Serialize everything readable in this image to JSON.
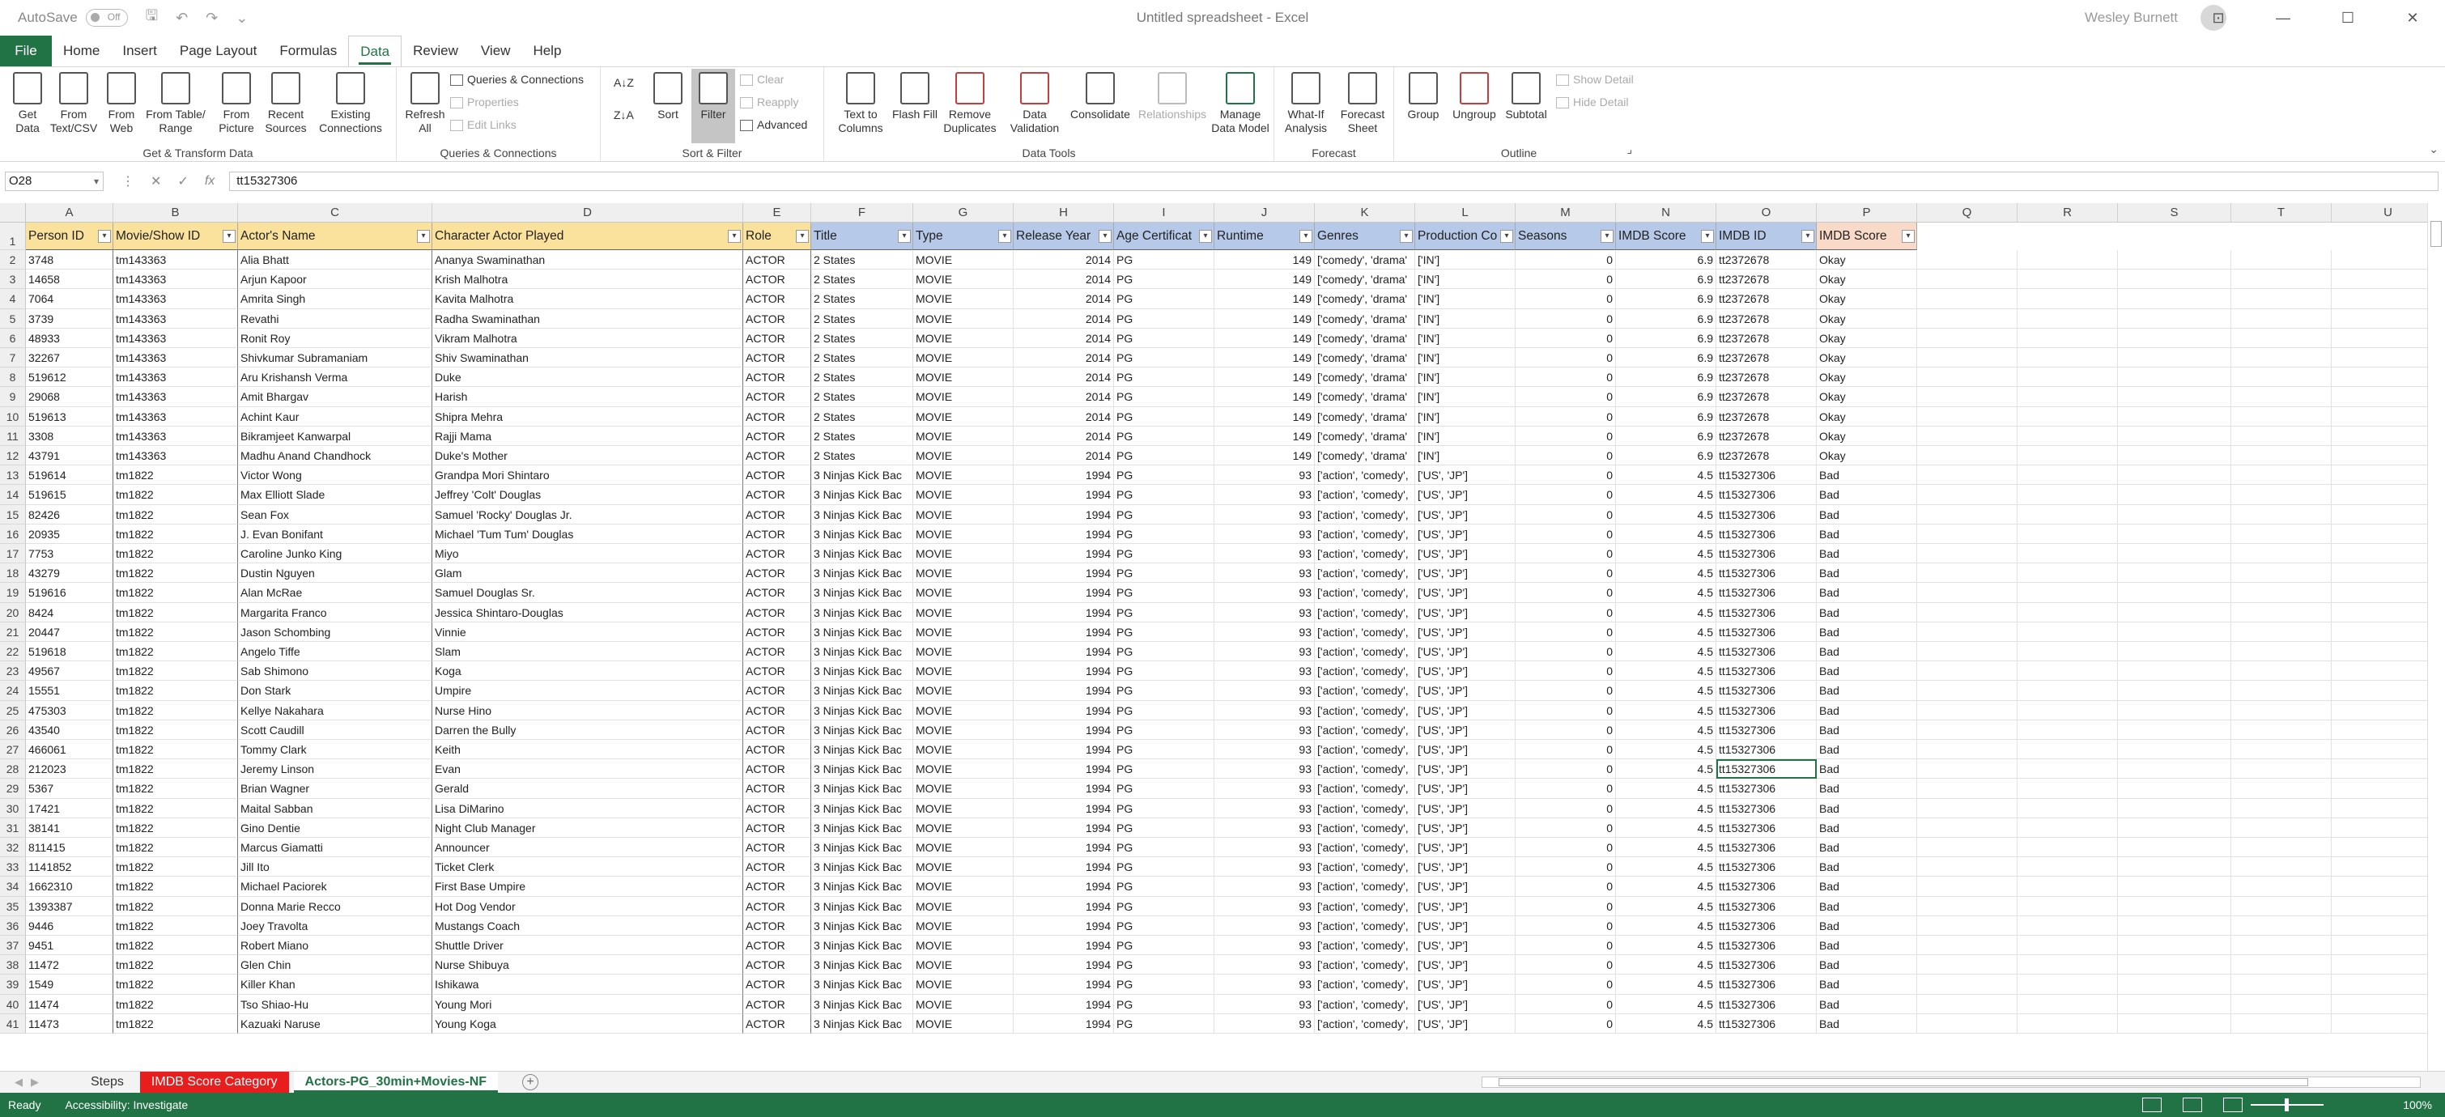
{
  "titlebar": {
    "autosave_label": "AutoSave",
    "autosave_state": "Off",
    "doc_title": "Untitled spreadsheet  -  Excel",
    "user_name": "Wesley Burnett"
  },
  "menu": {
    "file": "File",
    "tabs": [
      "Home",
      "Insert",
      "Page Layout",
      "Formulas",
      "Data",
      "Review",
      "View",
      "Help"
    ],
    "active_tab": "Data"
  },
  "ribbon": {
    "get_transform": {
      "name": "Get & Transform Data",
      "buttons": [
        "Get Data",
        "From Text/CSV",
        "From Web",
        "From Table/ Range",
        "From Picture",
        "Recent Sources",
        "Existing Connections"
      ]
    },
    "queries": {
      "name": "Queries & Connections",
      "refresh": "Refresh All",
      "items": [
        "Queries & Connections",
        "Properties",
        "Edit Links"
      ]
    },
    "sort_filter": {
      "name": "Sort & Filter",
      "sort": "Sort",
      "filter": "Filter",
      "items": [
        "Clear",
        "Reapply",
        "Advanced"
      ]
    },
    "data_tools": {
      "name": "Data Tools",
      "buttons": [
        "Text to Columns",
        "Flash Fill",
        "Remove Duplicates",
        "Data Validation",
        "Consolidate",
        "Relationships",
        "Manage Data Model"
      ]
    },
    "forecast": {
      "name": "Forecast",
      "buttons": [
        "What-If Analysis",
        "Forecast Sheet"
      ]
    },
    "outline": {
      "name": "Outline",
      "buttons": [
        "Group",
        "Ungroup",
        "Subtotal"
      ],
      "items": [
        "Show Detail",
        "Hide Detail"
      ]
    }
  },
  "formula_bar": {
    "name_box": "O28",
    "formula": "tt15327306"
  },
  "columns": [
    "A",
    "B",
    "C",
    "D",
    "E",
    "F",
    "G",
    "H",
    "I",
    "J",
    "K",
    "L",
    "M",
    "N",
    "O",
    "P",
    "Q",
    "R",
    "S",
    "T",
    "U"
  ],
  "headers": [
    "Person ID",
    "Movie/Show ID",
    "Actor's Name",
    "Character Actor Played",
    "Role",
    "Title",
    "Type",
    "Release Year",
    "Age Certificat",
    "Runtime",
    "Genres",
    "Production Co",
    "Seasons",
    "IMDB Score",
    "IMDB ID",
    "IMDB Score"
  ],
  "rows": [
    [
      "3748",
      "tm143363",
      "Alia Bhatt",
      "Ananya Swaminathan",
      "ACTOR",
      "2 States",
      "MOVIE",
      "2014",
      "PG",
      "149",
      "['comedy', 'drama'",
      "['IN']",
      "0",
      "6.9",
      "tt2372678",
      "Okay"
    ],
    [
      "14658",
      "tm143363",
      "Arjun Kapoor",
      "Krish Malhotra",
      "ACTOR",
      "2 States",
      "MOVIE",
      "2014",
      "PG",
      "149",
      "['comedy', 'drama'",
      "['IN']",
      "0",
      "6.9",
      "tt2372678",
      "Okay"
    ],
    [
      "7064",
      "tm143363",
      "Amrita Singh",
      "Kavita Malhotra",
      "ACTOR",
      "2 States",
      "MOVIE",
      "2014",
      "PG",
      "149",
      "['comedy', 'drama'",
      "['IN']",
      "0",
      "6.9",
      "tt2372678",
      "Okay"
    ],
    [
      "3739",
      "tm143363",
      "Revathi",
      "Radha Swaminathan",
      "ACTOR",
      "2 States",
      "MOVIE",
      "2014",
      "PG",
      "149",
      "['comedy', 'drama'",
      "['IN']",
      "0",
      "6.9",
      "tt2372678",
      "Okay"
    ],
    [
      "48933",
      "tm143363",
      "Ronit Roy",
      "Vikram Malhotra",
      "ACTOR",
      "2 States",
      "MOVIE",
      "2014",
      "PG",
      "149",
      "['comedy', 'drama'",
      "['IN']",
      "0",
      "6.9",
      "tt2372678",
      "Okay"
    ],
    [
      "32267",
      "tm143363",
      "Shivkumar Subramaniam",
      "Shiv Swaminathan",
      "ACTOR",
      "2 States",
      "MOVIE",
      "2014",
      "PG",
      "149",
      "['comedy', 'drama'",
      "['IN']",
      "0",
      "6.9",
      "tt2372678",
      "Okay"
    ],
    [
      "519612",
      "tm143363",
      "Aru Krishansh Verma",
      "Duke",
      "ACTOR",
      "2 States",
      "MOVIE",
      "2014",
      "PG",
      "149",
      "['comedy', 'drama'",
      "['IN']",
      "0",
      "6.9",
      "tt2372678",
      "Okay"
    ],
    [
      "29068",
      "tm143363",
      "Amit Bhargav",
      "Harish",
      "ACTOR",
      "2 States",
      "MOVIE",
      "2014",
      "PG",
      "149",
      "['comedy', 'drama'",
      "['IN']",
      "0",
      "6.9",
      "tt2372678",
      "Okay"
    ],
    [
      "519613",
      "tm143363",
      "Achint Kaur",
      "Shipra Mehra",
      "ACTOR",
      "2 States",
      "MOVIE",
      "2014",
      "PG",
      "149",
      "['comedy', 'drama'",
      "['IN']",
      "0",
      "6.9",
      "tt2372678",
      "Okay"
    ],
    [
      "3308",
      "tm143363",
      "Bikramjeet Kanwarpal",
      "Rajji Mama",
      "ACTOR",
      "2 States",
      "MOVIE",
      "2014",
      "PG",
      "149",
      "['comedy', 'drama'",
      "['IN']",
      "0",
      "6.9",
      "tt2372678",
      "Okay"
    ],
    [
      "43791",
      "tm143363",
      "Madhu Anand Chandhock",
      "Duke's Mother",
      "ACTOR",
      "2 States",
      "MOVIE",
      "2014",
      "PG",
      "149",
      "['comedy', 'drama'",
      "['IN']",
      "0",
      "6.9",
      "tt2372678",
      "Okay"
    ],
    [
      "519614",
      "tm1822",
      "Victor Wong",
      "Grandpa Mori Shintaro",
      "ACTOR",
      "3 Ninjas Kick Bac",
      "MOVIE",
      "1994",
      "PG",
      "93",
      "['action', 'comedy',",
      "['US', 'JP']",
      "0",
      "4.5",
      "tt15327306",
      "Bad"
    ],
    [
      "519615",
      "tm1822",
      "Max Elliott Slade",
      "Jeffrey 'Colt' Douglas",
      "ACTOR",
      "3 Ninjas Kick Bac",
      "MOVIE",
      "1994",
      "PG",
      "93",
      "['action', 'comedy',",
      "['US', 'JP']",
      "0",
      "4.5",
      "tt15327306",
      "Bad"
    ],
    [
      "82426",
      "tm1822",
      "Sean Fox",
      "Samuel 'Rocky' Douglas Jr.",
      "ACTOR",
      "3 Ninjas Kick Bac",
      "MOVIE",
      "1994",
      "PG",
      "93",
      "['action', 'comedy',",
      "['US', 'JP']",
      "0",
      "4.5",
      "tt15327306",
      "Bad"
    ],
    [
      "20935",
      "tm1822",
      "J. Evan Bonifant",
      "Michael 'Tum Tum' Douglas",
      "ACTOR",
      "3 Ninjas Kick Bac",
      "MOVIE",
      "1994",
      "PG",
      "93",
      "['action', 'comedy',",
      "['US', 'JP']",
      "0",
      "4.5",
      "tt15327306",
      "Bad"
    ],
    [
      "7753",
      "tm1822",
      "Caroline Junko King",
      "Miyo",
      "ACTOR",
      "3 Ninjas Kick Bac",
      "MOVIE",
      "1994",
      "PG",
      "93",
      "['action', 'comedy',",
      "['US', 'JP']",
      "0",
      "4.5",
      "tt15327306",
      "Bad"
    ],
    [
      "43279",
      "tm1822",
      "Dustin Nguyen",
      "Glam",
      "ACTOR",
      "3 Ninjas Kick Bac",
      "MOVIE",
      "1994",
      "PG",
      "93",
      "['action', 'comedy',",
      "['US', 'JP']",
      "0",
      "4.5",
      "tt15327306",
      "Bad"
    ],
    [
      "519616",
      "tm1822",
      "Alan McRae",
      "Samuel Douglas Sr.",
      "ACTOR",
      "3 Ninjas Kick Bac",
      "MOVIE",
      "1994",
      "PG",
      "93",
      "['action', 'comedy',",
      "['US', 'JP']",
      "0",
      "4.5",
      "tt15327306",
      "Bad"
    ],
    [
      "8424",
      "tm1822",
      "Margarita Franco",
      "Jessica Shintaro-Douglas",
      "ACTOR",
      "3 Ninjas Kick Bac",
      "MOVIE",
      "1994",
      "PG",
      "93",
      "['action', 'comedy',",
      "['US', 'JP']",
      "0",
      "4.5",
      "tt15327306",
      "Bad"
    ],
    [
      "20447",
      "tm1822",
      "Jason Schombing",
      "Vinnie",
      "ACTOR",
      "3 Ninjas Kick Bac",
      "MOVIE",
      "1994",
      "PG",
      "93",
      "['action', 'comedy',",
      "['US', 'JP']",
      "0",
      "4.5",
      "tt15327306",
      "Bad"
    ],
    [
      "519618",
      "tm1822",
      "Angelo Tiffe",
      "Slam",
      "ACTOR",
      "3 Ninjas Kick Bac",
      "MOVIE",
      "1994",
      "PG",
      "93",
      "['action', 'comedy',",
      "['US', 'JP']",
      "0",
      "4.5",
      "tt15327306",
      "Bad"
    ],
    [
      "49567",
      "tm1822",
      "Sab Shimono",
      "Koga",
      "ACTOR",
      "3 Ninjas Kick Bac",
      "MOVIE",
      "1994",
      "PG",
      "93",
      "['action', 'comedy',",
      "['US', 'JP']",
      "0",
      "4.5",
      "tt15327306",
      "Bad"
    ],
    [
      "15551",
      "tm1822",
      "Don Stark",
      "Umpire",
      "ACTOR",
      "3 Ninjas Kick Bac",
      "MOVIE",
      "1994",
      "PG",
      "93",
      "['action', 'comedy',",
      "['US', 'JP']",
      "0",
      "4.5",
      "tt15327306",
      "Bad"
    ],
    [
      "475303",
      "tm1822",
      "Kellye Nakahara",
      "Nurse Hino",
      "ACTOR",
      "3 Ninjas Kick Bac",
      "MOVIE",
      "1994",
      "PG",
      "93",
      "['action', 'comedy',",
      "['US', 'JP']",
      "0",
      "4.5",
      "tt15327306",
      "Bad"
    ],
    [
      "43540",
      "tm1822",
      "Scott Caudill",
      "Darren the Bully",
      "ACTOR",
      "3 Ninjas Kick Bac",
      "MOVIE",
      "1994",
      "PG",
      "93",
      "['action', 'comedy',",
      "['US', 'JP']",
      "0",
      "4.5",
      "tt15327306",
      "Bad"
    ],
    [
      "466061",
      "tm1822",
      "Tommy Clark",
      "Keith",
      "ACTOR",
      "3 Ninjas Kick Bac",
      "MOVIE",
      "1994",
      "PG",
      "93",
      "['action', 'comedy',",
      "['US', 'JP']",
      "0",
      "4.5",
      "tt15327306",
      "Bad"
    ],
    [
      "212023",
      "tm1822",
      "Jeremy Linson",
      "Evan",
      "ACTOR",
      "3 Ninjas Kick Bac",
      "MOVIE",
      "1994",
      "PG",
      "93",
      "['action', 'comedy',",
      "['US', 'JP']",
      "0",
      "4.5",
      "tt15327306",
      "Bad"
    ],
    [
      "5367",
      "tm1822",
      "Brian Wagner",
      "Gerald",
      "ACTOR",
      "3 Ninjas Kick Bac",
      "MOVIE",
      "1994",
      "PG",
      "93",
      "['action', 'comedy',",
      "['US', 'JP']",
      "0",
      "4.5",
      "tt15327306",
      "Bad"
    ],
    [
      "17421",
      "tm1822",
      "Maital Sabban",
      "Lisa DiMarino",
      "ACTOR",
      "3 Ninjas Kick Bac",
      "MOVIE",
      "1994",
      "PG",
      "93",
      "['action', 'comedy',",
      "['US', 'JP']",
      "0",
      "4.5",
      "tt15327306",
      "Bad"
    ],
    [
      "38141",
      "tm1822",
      "Gino Dentie",
      "Night Club Manager",
      "ACTOR",
      "3 Ninjas Kick Bac",
      "MOVIE",
      "1994",
      "PG",
      "93",
      "['action', 'comedy',",
      "['US', 'JP']",
      "0",
      "4.5",
      "tt15327306",
      "Bad"
    ],
    [
      "811415",
      "tm1822",
      "Marcus Giamatti",
      "Announcer",
      "ACTOR",
      "3 Ninjas Kick Bac",
      "MOVIE",
      "1994",
      "PG",
      "93",
      "['action', 'comedy',",
      "['US', 'JP']",
      "0",
      "4.5",
      "tt15327306",
      "Bad"
    ],
    [
      "1141852",
      "tm1822",
      "Jill Ito",
      "Ticket Clerk",
      "ACTOR",
      "3 Ninjas Kick Bac",
      "MOVIE",
      "1994",
      "PG",
      "93",
      "['action', 'comedy',",
      "['US', 'JP']",
      "0",
      "4.5",
      "tt15327306",
      "Bad"
    ],
    [
      "1662310",
      "tm1822",
      "Michael Paciorek",
      "First Base Umpire",
      "ACTOR",
      "3 Ninjas Kick Bac",
      "MOVIE",
      "1994",
      "PG",
      "93",
      "['action', 'comedy',",
      "['US', 'JP']",
      "0",
      "4.5",
      "tt15327306",
      "Bad"
    ],
    [
      "1393387",
      "tm1822",
      "Donna Marie Recco",
      "Hot Dog Vendor",
      "ACTOR",
      "3 Ninjas Kick Bac",
      "MOVIE",
      "1994",
      "PG",
      "93",
      "['action', 'comedy',",
      "['US', 'JP']",
      "0",
      "4.5",
      "tt15327306",
      "Bad"
    ],
    [
      "9446",
      "tm1822",
      "Joey Travolta",
      "Mustangs Coach",
      "ACTOR",
      "3 Ninjas Kick Bac",
      "MOVIE",
      "1994",
      "PG",
      "93",
      "['action', 'comedy',",
      "['US', 'JP']",
      "0",
      "4.5",
      "tt15327306",
      "Bad"
    ],
    [
      "9451",
      "tm1822",
      "Robert Miano",
      "Shuttle Driver",
      "ACTOR",
      "3 Ninjas Kick Bac",
      "MOVIE",
      "1994",
      "PG",
      "93",
      "['action', 'comedy',",
      "['US', 'JP']",
      "0",
      "4.5",
      "tt15327306",
      "Bad"
    ],
    [
      "11472",
      "tm1822",
      "Glen Chin",
      "Nurse Shibuya",
      "ACTOR",
      "3 Ninjas Kick Bac",
      "MOVIE",
      "1994",
      "PG",
      "93",
      "['action', 'comedy',",
      "['US', 'JP']",
      "0",
      "4.5",
      "tt15327306",
      "Bad"
    ],
    [
      "1549",
      "tm1822",
      "Killer Khan",
      "Ishikawa",
      "ACTOR",
      "3 Ninjas Kick Bac",
      "MOVIE",
      "1994",
      "PG",
      "93",
      "['action', 'comedy',",
      "['US', 'JP']",
      "0",
      "4.5",
      "tt15327306",
      "Bad"
    ],
    [
      "11474",
      "tm1822",
      "Tso Shiao-Hu",
      "Young Mori",
      "ACTOR",
      "3 Ninjas Kick Bac",
      "MOVIE",
      "1994",
      "PG",
      "93",
      "['action', 'comedy',",
      "['US', 'JP']",
      "0",
      "4.5",
      "tt15327306",
      "Bad"
    ],
    [
      "11473",
      "tm1822",
      "Kazuaki Naruse",
      "Young Koga",
      "ACTOR",
      "3 Ninjas Kick Bac",
      "MOVIE",
      "1994",
      "PG",
      "93",
      "['action', 'comedy',",
      "['US', 'JP']",
      "0",
      "4.5",
      "tt15327306",
      "Bad"
    ]
  ],
  "sheet_tabs": [
    "Steps",
    "IMDB Score Category",
    "Actors-PG_30min+Movies-NF"
  ],
  "active_sheet": "Actors-PG_30min+Movies-NF",
  "status": {
    "ready": "Ready",
    "accessibility": "Accessibility: Investigate",
    "zoom": "100%"
  },
  "colors": {
    "accent": "#217346",
    "header_yellow": "#fbe29c",
    "header_blue": "#b7c9e8",
    "header_pink": "#f9d9c8",
    "tab_red": "#e81e1e"
  }
}
